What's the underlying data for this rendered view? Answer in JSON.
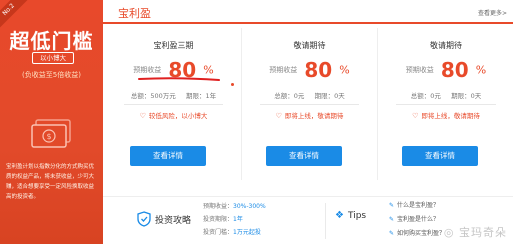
{
  "promo": {
    "corner_text": "No.2",
    "title": "超低门槛",
    "sub_pill": "以小博大",
    "hint": "(负收益至5倍收益)",
    "desc": "宝利盈计划以指数分化的方式购买优质的权益产品，将未获收益，少可大赚，适合想要享受一定风险换取收益高的投资者。"
  },
  "topbar": {
    "tab": "宝利盈",
    "more": "查看更多>"
  },
  "cards": [
    {
      "name": "宝利盈三期",
      "rate_label": "预期收益",
      "rate": "80",
      "pct": "%",
      "total_label": "总额：",
      "total": "500万元",
      "period_label": "期限：",
      "period": "1年",
      "tagline": "较低风险，以小博大",
      "button": "查看详情"
    },
    {
      "name": "敬请期待",
      "rate_label": "预期收益",
      "rate": "80",
      "pct": "%",
      "total_label": "总额：",
      "total": "0元",
      "period_label": "期限：",
      "period": "0天",
      "tagline": "即将上线，敬请期待",
      "button": "查看详情"
    },
    {
      "name": "敬请期待",
      "rate_label": "预期收益",
      "rate": "80",
      "pct": "%",
      "total_label": "总额：",
      "total": "0元",
      "period_label": "期限：",
      "period": "0天",
      "tagline": "即将上线，敬请期待",
      "button": "查看详情"
    }
  ],
  "bottom": {
    "invest_title": "投资攻略",
    "lines": [
      {
        "label": "预期收益：",
        "value": "30%-300%"
      },
      {
        "label": "投资期限：",
        "value": "1年"
      },
      {
        "label": "投资门槛：",
        "value": "1万元起投"
      }
    ],
    "tips_title": "Tips",
    "tips": [
      "什么是宝利盈？",
      "宝利盈是什么？",
      "如何购买宝利盈？"
    ],
    "watermark": "宝玛奇朵"
  },
  "colors": {
    "brand_red": "#e84a2a",
    "button_blue": "#1a8be6"
  }
}
